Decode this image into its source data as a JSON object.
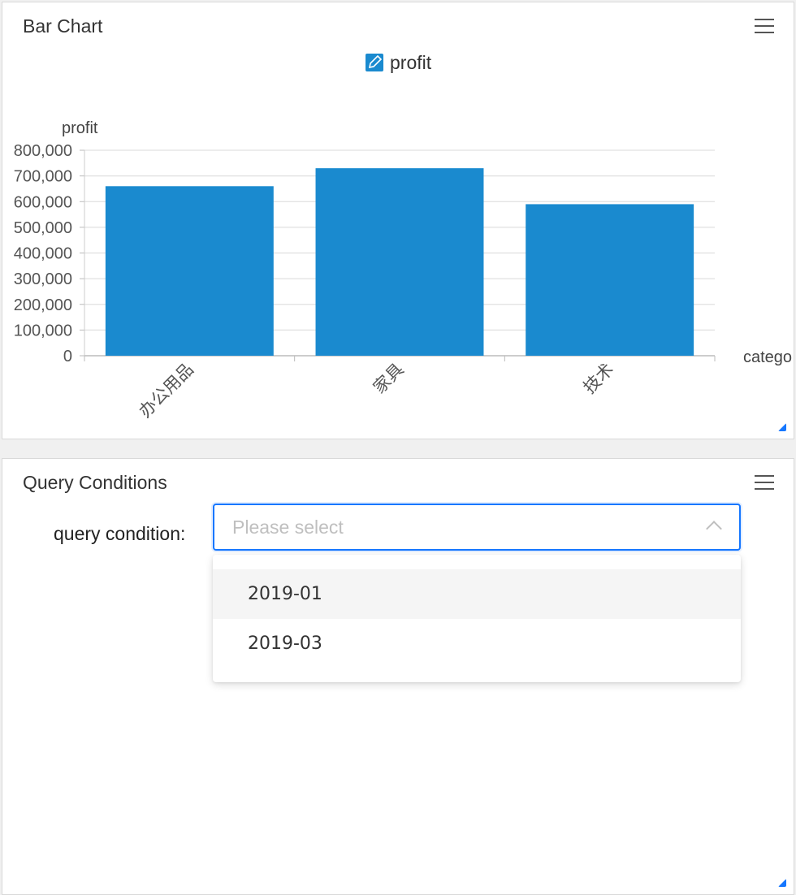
{
  "chart_panel": {
    "title": "Bar Chart"
  },
  "query_panel": {
    "title": "Query Conditions",
    "label": "query condition:",
    "placeholder": "Please select",
    "options": [
      "2019-01",
      "2019-03"
    ]
  },
  "colors": {
    "bar": "#1a8acf",
    "accent": "#1677ff",
    "legend_icon": "#1a8acf"
  },
  "chart_data": {
    "type": "bar",
    "title": "profit",
    "ylabel": "profit",
    "xlabel": "catego",
    "categories": [
      "办公用品",
      "家具",
      "技术"
    ],
    "series": [
      {
        "name": "profit",
        "values": [
          660000,
          730000,
          590000
        ]
      }
    ],
    "ylim": [
      0,
      800000
    ],
    "yticks": [
      "0",
      "100,000",
      "200,000",
      "300,000",
      "400,000",
      "500,000",
      "600,000",
      "700,000",
      "800,000"
    ],
    "grid": true,
    "legend": "top-center"
  }
}
